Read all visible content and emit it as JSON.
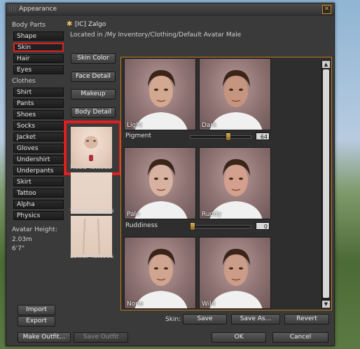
{
  "window": {
    "title": "Appearance"
  },
  "nav": {
    "body_parts_label": "Body Parts",
    "body_parts": [
      "Shape",
      "Skin",
      "Hair",
      "Eyes"
    ],
    "clothes_label": "Clothes",
    "clothes": [
      "Shirt",
      "Pants",
      "Shoes",
      "Socks",
      "Jacket",
      "Gloves",
      "Undershirt",
      "Underpants",
      "Skirt",
      "Tattoo",
      "Alpha",
      "Physics"
    ],
    "selected": "Skin",
    "avatar_height_label": "Avatar Height:",
    "avatar_height_m": "2.03m",
    "avatar_height_ft": "6'7\"",
    "import_label": "Import",
    "export_label": "Export"
  },
  "item": {
    "name": "[IC] Zalgo",
    "location": "Located in /My Inventory/Clothing/Default Avatar Male"
  },
  "sub_buttons": [
    "Skin Color",
    "Face Detail",
    "Makeup",
    "Body Detail"
  ],
  "tattoos": [
    {
      "label": "Head Tattoos",
      "highlighted": true
    },
    {
      "label": "Upper Tattoos",
      "highlighted": false
    },
    {
      "label": "Lower Tattoos",
      "highlighted": false
    }
  ],
  "params": {
    "row1": {
      "left": "Light",
      "right": "Dark"
    },
    "pigment": {
      "label": "Pigment",
      "value": "64",
      "fraction": 0.64
    },
    "row2": {
      "left": "Pale",
      "right": "Ruddy"
    },
    "ruddiness": {
      "label": "Ruddiness",
      "value": "0",
      "fraction": 0.0
    },
    "row3": {
      "left": "None",
      "right": "Wild"
    }
  },
  "save_row": {
    "label": "Skin:",
    "save": "Save",
    "save_as": "Save As...",
    "revert": "Revert"
  },
  "footer": {
    "make_outfit": "Make Outfit...",
    "save_outfit": "Save Outfit",
    "ok": "OK",
    "cancel": "Cancel"
  },
  "colors": {
    "accent": "#c07a18",
    "highlight": "#e02020"
  }
}
